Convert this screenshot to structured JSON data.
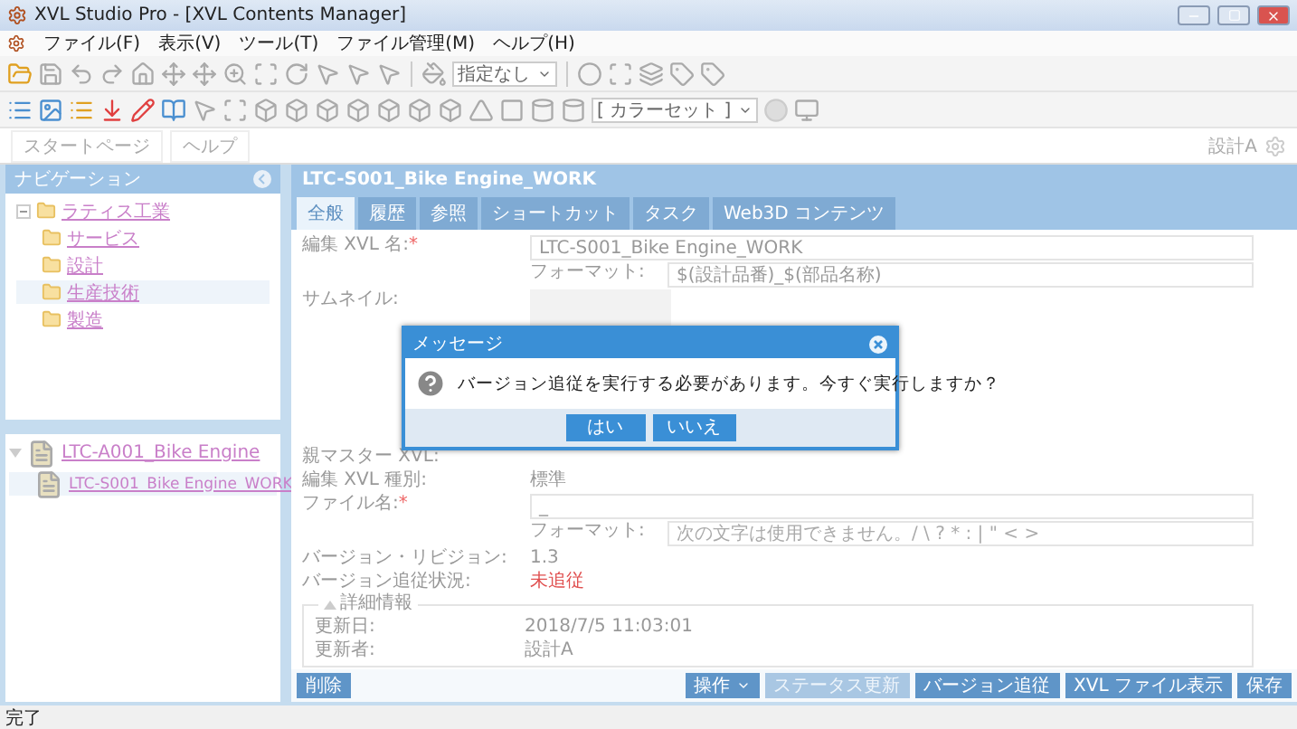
{
  "window": {
    "title": "XVL Studio Pro - [XVL Contents Manager]"
  },
  "menu": [
    "ファイル(F)",
    "表示(V)",
    "ツール(T)",
    "ファイル管理(M)",
    "ヘルプ(H)"
  ],
  "toolbar": {
    "view_select": "指定なし",
    "color_select": "[ カラーセット ]"
  },
  "doc_tabs": [
    {
      "label": "スタートページ",
      "selected": false
    },
    {
      "label": "ヘルプ",
      "selected": false
    }
  ],
  "user": "設計A",
  "navigation": {
    "title": "ナビゲーション",
    "tree": [
      {
        "label": "ラティス工業",
        "expanded": true,
        "selected": false,
        "children": [
          {
            "label": "サービス",
            "selected": false
          },
          {
            "label": "設計",
            "selected": false
          },
          {
            "label": "生産技術",
            "selected": true
          },
          {
            "label": "製造",
            "selected": false
          }
        ]
      }
    ]
  },
  "version_tree": [
    {
      "label": "LTC-A001_Bike Engine",
      "expanded": true,
      "children": [
        {
          "label": "LTC-S001_Bike Engine_WORK"
        }
      ]
    }
  ],
  "detail": {
    "title": "LTC-S001_Bike Engine_WORK",
    "tabs": [
      {
        "label": "全般",
        "selected": true
      },
      {
        "label": "履歴",
        "selected": false
      },
      {
        "label": "参照",
        "selected": false
      },
      {
        "label": "ショートカット",
        "selected": false
      },
      {
        "label": "タスク",
        "selected": false
      },
      {
        "label": "Web3D コンテンツ",
        "selected": false
      }
    ],
    "name_label": "編集 XVL 名:",
    "name_required": "*",
    "name_value": "LTC-S001_Bike Engine_WORK",
    "name_format_label": "フォーマット:",
    "name_format_value": "$(設計品番)_$(部品名称)",
    "thumbnail_label": "サムネイル:",
    "parent_label": "親マスター XVL:",
    "type_label": "編集 XVL 種別:",
    "type_value": "標準",
    "file_label": "ファイル名:",
    "file_required": "*",
    "file_value": "_",
    "file_format_label": "フォーマット:",
    "file_format_placeholder": "次の文字は使用できません。/ \\ ? * : | \" < >",
    "version_label": "バージョン・リビジョン:",
    "version_value": "1.3",
    "follow_label": "バージョン追従状況:",
    "follow_value": "未追従",
    "details": {
      "title": "詳細情報",
      "expanded": true,
      "rows": [
        {
          "label": "更新日:",
          "value": "2018/7/5 11:03:01"
        },
        {
          "label": "更新者:",
          "value": "設計A"
        }
      ]
    }
  },
  "buttons": {
    "delete": "削除",
    "right": [
      {
        "label": "操作",
        "kind": "menu",
        "disabled": false
      },
      {
        "label": "ステータス更新",
        "kind": "plain",
        "disabled": true
      },
      {
        "label": "バージョン追従",
        "kind": "plain",
        "disabled": false
      },
      {
        "label": "XVL ファイル表示",
        "kind": "plain",
        "disabled": false
      },
      {
        "label": "保存",
        "kind": "plain",
        "disabled": false
      }
    ]
  },
  "dialog": {
    "title": "メッセージ",
    "message": "バージョン追従を実行する必要があります。今すぐ実行しますか？",
    "buttons": [
      "はい",
      "いいえ"
    ]
  },
  "status_bar": "完了"
}
